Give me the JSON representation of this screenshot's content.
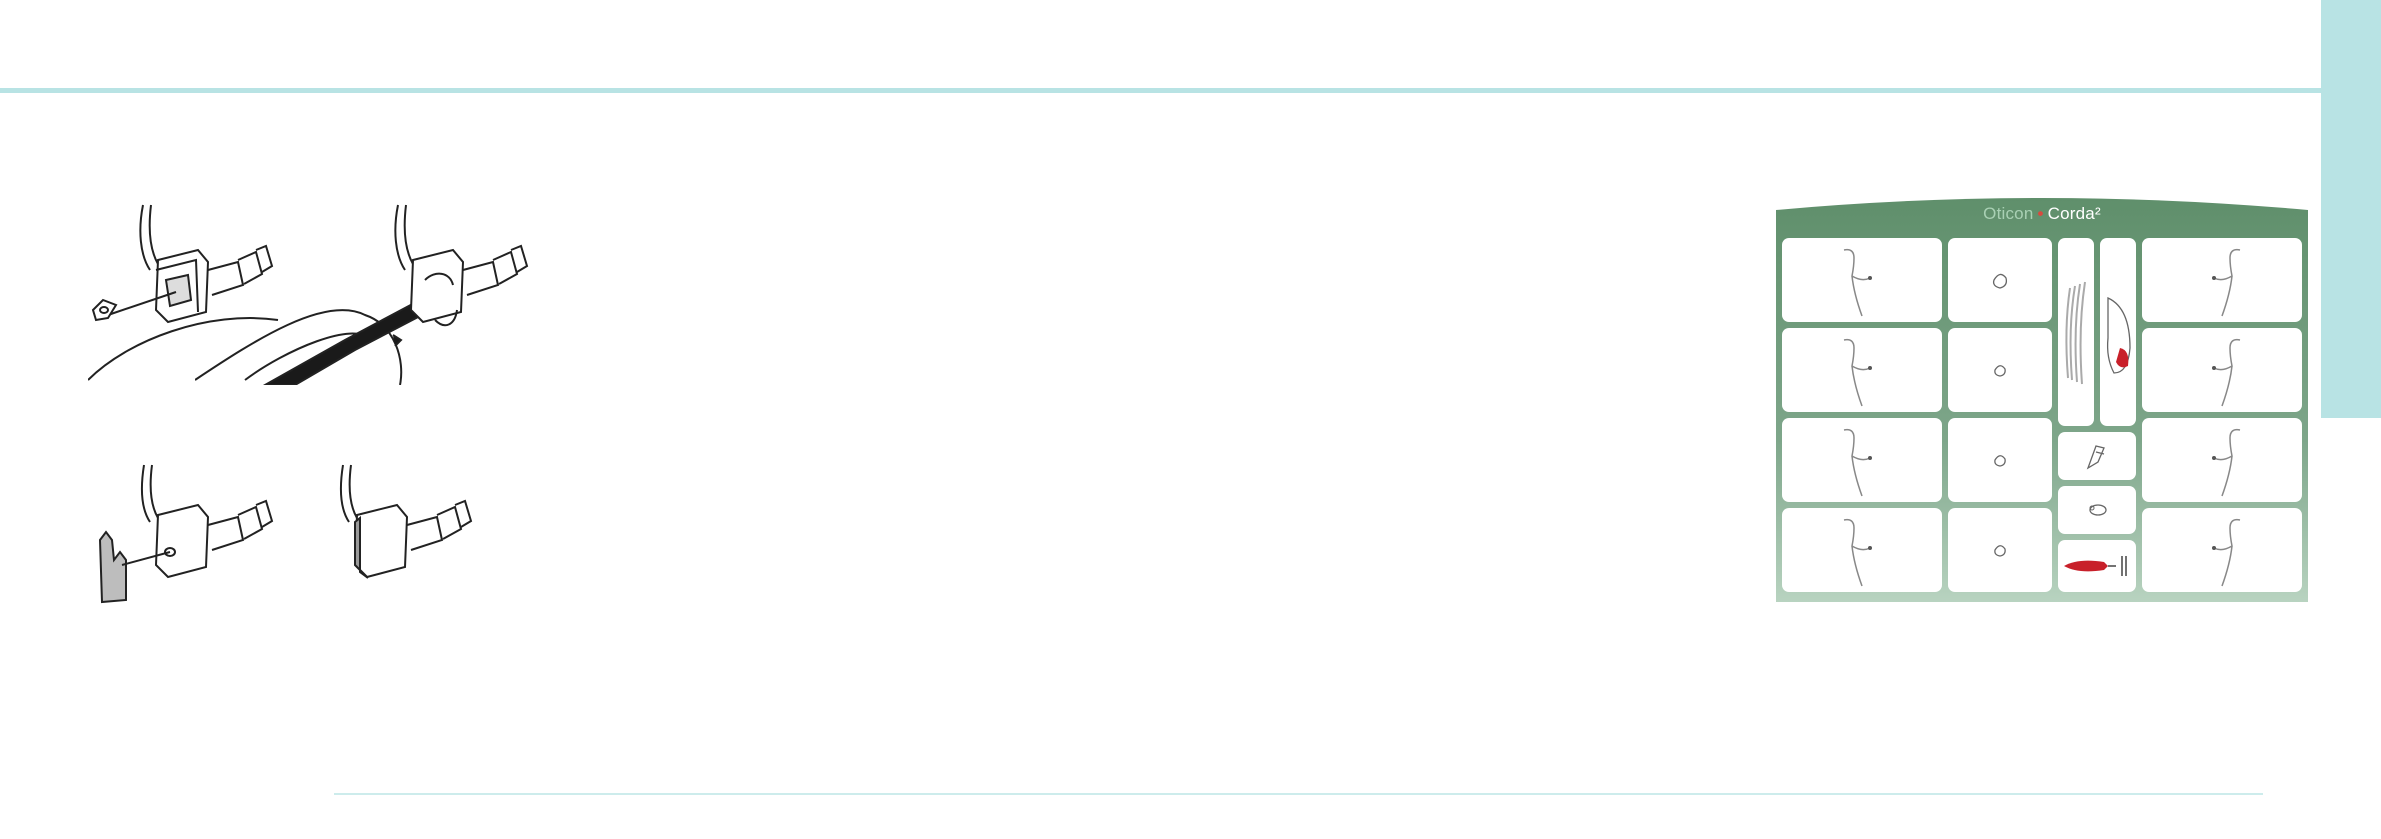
{
  "kit": {
    "brand": "Oticon",
    "separator": "•",
    "model": "Corda²"
  }
}
